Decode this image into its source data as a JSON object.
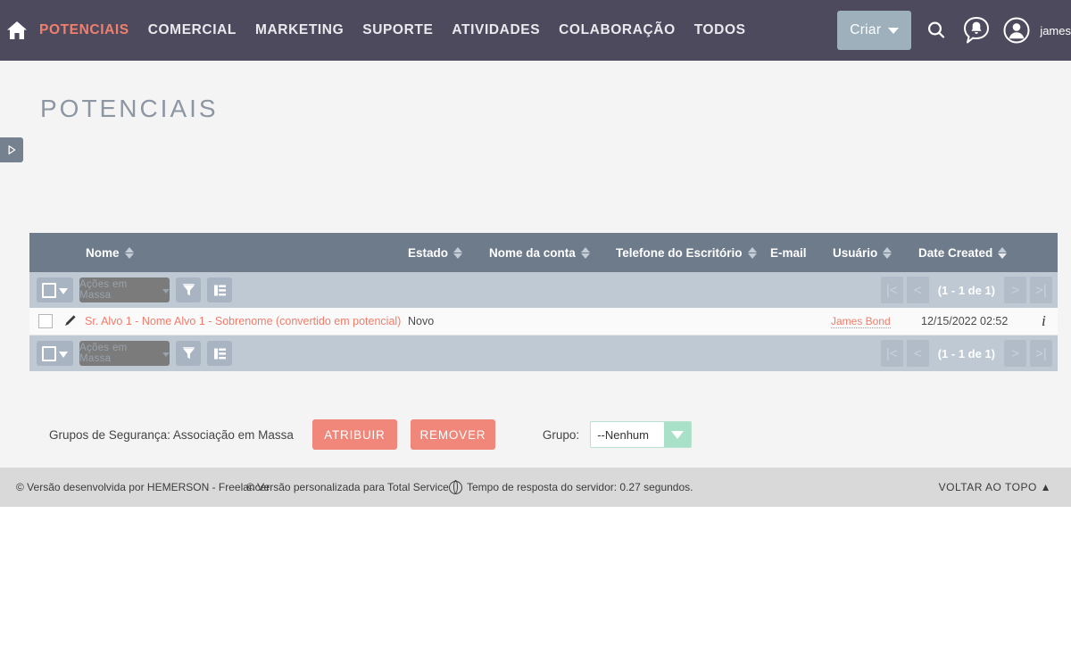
{
  "topnav": {
    "home_icon": "home-icon",
    "items": [
      {
        "label": "POTENCIAIS",
        "active": true
      },
      {
        "label": "COMERCIAL",
        "active": false
      },
      {
        "label": "MARKETING",
        "active": false
      },
      {
        "label": "SUPORTE",
        "active": false
      },
      {
        "label": "ATIVIDADES",
        "active": false
      },
      {
        "label": "COLABORAÇÃO",
        "active": false
      },
      {
        "label": "TODOS",
        "active": false
      }
    ],
    "create_button": "Criar",
    "search_icon": "search-icon",
    "notification_icon": "notification-bell-icon",
    "account_icon": "user-account-icon",
    "username": "james",
    "bg_color": "#4e4a5e",
    "active_color": "#f0806d",
    "create_bg": "#9fb0bd"
  },
  "sidebar": {
    "toggle_icon": "expand-sidebar-arrow-icon"
  },
  "page": {
    "title": "POTENCIAIS",
    "bg_color": "#f4f4f4"
  },
  "table": {
    "header_bg": "#6e7b8b",
    "toolbar_bg": "#bfc9d4",
    "columns": [
      {
        "label": "Nome",
        "sorted": false
      },
      {
        "label": "Estado",
        "sorted": false
      },
      {
        "label": "Nome da conta",
        "sorted": false
      },
      {
        "label": "Telefone do Escritório",
        "sorted": false
      },
      {
        "label": "E-mail",
        "sortable": false
      },
      {
        "label": "Usuário",
        "sorted": false
      },
      {
        "label": "Date Created",
        "sorted": true
      }
    ],
    "toolbar": {
      "select_all_icon": "checkbox-dropdown-icon",
      "bulk_action_label": "Ações em Massa",
      "filter_icon": "funnel-filter-icon",
      "columns_icon": "column-chooser-icon"
    },
    "pagination": {
      "first_icon": "first-page-icon",
      "prev_icon": "previous-page-icon",
      "count_label": "(1 - 1 de 1)",
      "next_icon": "next-page-icon",
      "last_icon": "last-page-icon"
    },
    "rows": [
      {
        "edit_icon": "pencil-edit-icon",
        "name": "Sr. Alvo 1 - Nome Alvo 1 - Sobrenome (convertido em potencial)",
        "estado": "Novo",
        "nome_da_conta": "",
        "telefone": "",
        "email": "",
        "usuario": "James Bond",
        "date_created": "12/15/2022 02:52",
        "info_icon": "info-icon"
      }
    ],
    "link_color": "#ef7d6b"
  },
  "mass_assign": {
    "label": "Grupos de Segurança: Associação em Massa",
    "assign_button": "ATRIBUIR",
    "remove_button": "REMOVER",
    "group_label": "Grupo:",
    "group_value": "--Nenhum",
    "button_color": "#f0877a",
    "select_accent": "#a8e0c8"
  },
  "footer": {
    "credit_1": "© Versão desenvolvida por HEMERSON - Freelancer",
    "credit_2": "© Versão personalizada para Total Service",
    "server_icon": "globe-icon",
    "response_time": "Tempo de resposta do servidor: 0.27 segundos.",
    "back_to_top": "VOLTAR AO TOPO ▲",
    "bg_color": "#d9d9d9"
  }
}
